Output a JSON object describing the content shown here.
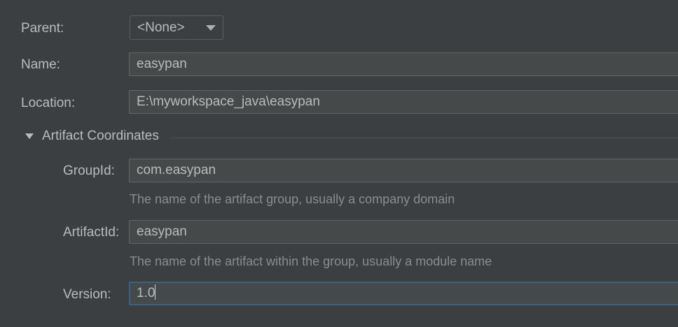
{
  "form": {
    "parent_label": "Parent:",
    "parent_value": "<None>",
    "name_label": "Name:",
    "name_value": "easypan",
    "location_label": "Location:",
    "location_value": "E:\\myworkspace_java\\easypan"
  },
  "artifact": {
    "section_title": "Artifact Coordinates",
    "groupid_label": "GroupId:",
    "groupid_value": "com.easypan",
    "groupid_hint": "The name of the artifact group, usually a company domain",
    "artifactid_label": "ArtifactId:",
    "artifactid_value": "easypan",
    "artifactid_hint": "The name of the artifact within the group, usually a module name",
    "version_label": "Version:",
    "version_value": "1.0"
  },
  "icons": {
    "combo_arrow": "chevron-down-icon",
    "section_toggle": "triangle-down-icon"
  }
}
